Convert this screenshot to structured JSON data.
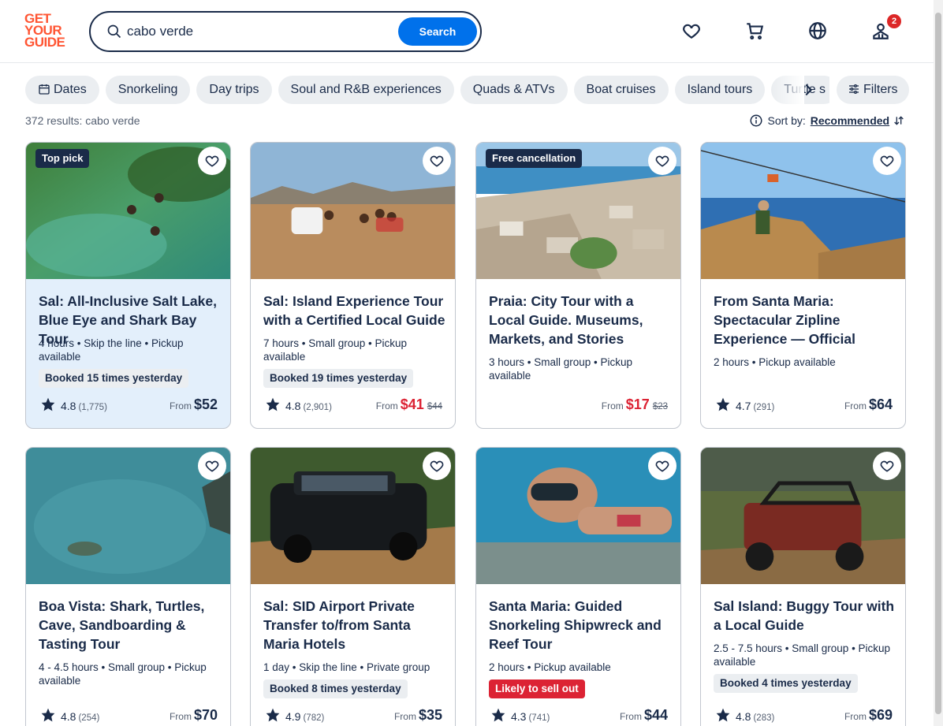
{
  "brand": {
    "logo_lines": [
      "GET",
      "YOUR",
      "GUIDE"
    ],
    "color": "#ff5533"
  },
  "search": {
    "value": "cabo verde",
    "button": "Search"
  },
  "header": {
    "cart_badge": "2"
  },
  "chips": [
    "Dates",
    "Snorkeling",
    "Day trips",
    "Soul and R&B experiences",
    "Quads & ATVs",
    "Boat cruises",
    "Island tours",
    "Turtle s"
  ],
  "filters_label": "Filters",
  "results_text": "372 results: cabo verde",
  "sort": {
    "label": "Sort by:",
    "value": "Recommended"
  },
  "cards": [
    {
      "tag": "Top pick",
      "title": "Sal: All-Inclusive Salt Lake, Blue Eye and Shark Bay Tour",
      "meta": "4 hours • Skip the line • Pickup available",
      "booked": "Booked 15 times yesterday",
      "rating": "4.8",
      "count": "(1,775)",
      "from": "From",
      "price": "$52",
      "old": ""
    },
    {
      "tag": "",
      "title": "Sal: Island Experience Tour with a Certified Local Guide",
      "meta": "7 hours • Small group • Pickup available",
      "booked": "Booked 19 times yesterday",
      "rating": "4.8",
      "count": "(2,901)",
      "from": "From",
      "price": "$41",
      "old": "$44"
    },
    {
      "tag": "Free cancellation",
      "title": "Praia: City Tour with a Local Guide. Museums, Markets, and Stories",
      "meta": "3 hours • Small group • Pickup available",
      "booked": "",
      "rating": "",
      "count": "",
      "from": "From",
      "price": "$17",
      "old": "$23"
    },
    {
      "tag": "",
      "title": "From Santa Maria: Spectacular Zipline Experience — Official",
      "meta": "2 hours • Pickup available",
      "booked": "",
      "rating": "4.7",
      "count": "(291)",
      "from": "From",
      "price": "$64",
      "old": ""
    },
    {
      "tag": "",
      "title": "Boa Vista: Shark, Turtles, Cave, Sandboarding & Tasting Tour",
      "meta": "4 - 4.5 hours • Small group • Pickup available",
      "booked": "",
      "rating": "4.8",
      "count": "(254)",
      "from": "From",
      "price": "$70",
      "old": ""
    },
    {
      "tag": "",
      "title": "Sal: SID Airport Private Transfer to/from Santa Maria Hotels",
      "meta": "1 day • Skip the line • Private group",
      "booked": "Booked 8 times yesterday",
      "rating": "4.9",
      "count": "(782)",
      "from": "From",
      "price": "$35",
      "old": ""
    },
    {
      "tag": "",
      "title": "Santa Maria: Guided Snorkeling Shipwreck and Reef Tour",
      "meta": "2 hours • Pickup available",
      "booked": "Likely to sell out",
      "rating": "4.3",
      "count": "(741)",
      "from": "From",
      "price": "$44",
      "old": ""
    },
    {
      "tag": "",
      "title": "Sal Island: Buggy Tour with a Local Guide",
      "meta": "2.5 - 7.5 hours • Small group • Pickup available",
      "booked": "Booked 4 times yesterday",
      "rating": "4.8",
      "count": "(283)",
      "from": "From",
      "price": "$69",
      "old": ""
    }
  ],
  "colors": {
    "accent": "#0071eb",
    "sale": "#dc2334",
    "text": "#1a2b49",
    "highlight": "#e3effb"
  }
}
